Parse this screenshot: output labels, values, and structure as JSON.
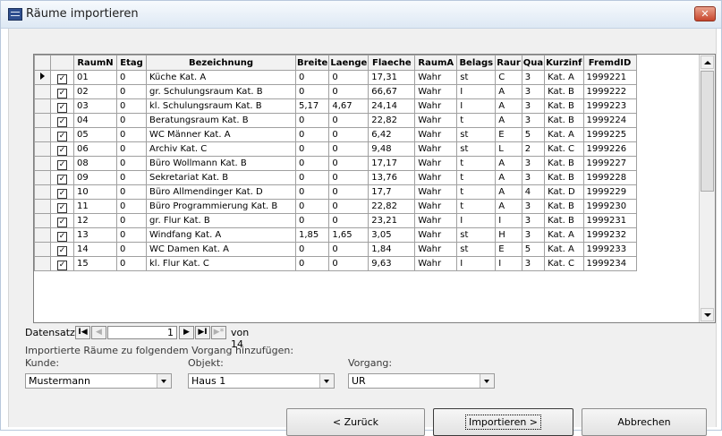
{
  "window": {
    "title": "Räume importieren",
    "close_glyph": "✕"
  },
  "grid": {
    "columns": [
      "RaumNr",
      "Etage",
      "Bezeichnung",
      "Breite",
      "Laenge",
      "Flaeche",
      "RaumArt",
      "Belags",
      "Raum",
      "Qua",
      "Kurzinf",
      "FremdID"
    ],
    "column_labels": [
      "RaumN",
      "Etag",
      "Bezeichnung",
      "Breite",
      "Laenge",
      "Flaeche",
      "RaumA",
      "Belags",
      "Raur",
      "Qua",
      "Kurzinf",
      "FremdID"
    ],
    "rows": [
      {
        "current": true,
        "checked": true,
        "cells": [
          "01",
          "0",
          "Küche Kat. A",
          "0",
          "0",
          "17,31",
          "Wahr",
          "st",
          "C",
          "3",
          "Kat. A",
          "1999221"
        ]
      },
      {
        "current": false,
        "checked": true,
        "cells": [
          "02",
          "0",
          "gr. Schulungsraum Kat. B",
          "0",
          "0",
          "66,67",
          "Wahr",
          "I",
          "A",
          "3",
          "Kat. B",
          "1999222"
        ]
      },
      {
        "current": false,
        "checked": true,
        "cells": [
          "03",
          "0",
          "kl. Schulungsraum Kat. B",
          "5,17",
          "4,67",
          "24,14",
          "Wahr",
          "I",
          "A",
          "3",
          "Kat. B",
          "1999223"
        ]
      },
      {
        "current": false,
        "checked": true,
        "cells": [
          "04",
          "0",
          "Beratungsraum Kat. B",
          "0",
          "0",
          "22,82",
          "Wahr",
          "t",
          "A",
          "3",
          "Kat. B",
          "1999224"
        ]
      },
      {
        "current": false,
        "checked": true,
        "cells": [
          "05",
          "0",
          "WC Männer Kat. A",
          "0",
          "0",
          "6,42",
          "Wahr",
          "st",
          "E",
          "5",
          "Kat. A",
          "1999225"
        ]
      },
      {
        "current": false,
        "checked": true,
        "cells": [
          "06",
          "0",
          "Archiv Kat. C",
          "0",
          "0",
          "9,48",
          "Wahr",
          "st",
          "L",
          "2",
          "Kat. C",
          "1999226"
        ]
      },
      {
        "current": false,
        "checked": true,
        "cells": [
          "08",
          "0",
          "Büro Wollmann Kat. B",
          "0",
          "0",
          "17,17",
          "Wahr",
          "t",
          "A",
          "3",
          "Kat. B",
          "1999227"
        ]
      },
      {
        "current": false,
        "checked": true,
        "cells": [
          "09",
          "0",
          "Sekretariat Kat. B",
          "0",
          "0",
          "13,76",
          "Wahr",
          "t",
          "A",
          "3",
          "Kat. B",
          "1999228"
        ]
      },
      {
        "current": false,
        "checked": true,
        "cells": [
          "10",
          "0",
          "Büro Allmendinger Kat. D",
          "0",
          "0",
          "17,7",
          "Wahr",
          "t",
          "A",
          "4",
          "Kat. D",
          "1999229"
        ]
      },
      {
        "current": false,
        "checked": true,
        "cells": [
          "11",
          "0",
          "Büro Programmierung Kat. B",
          "0",
          "0",
          "22,82",
          "Wahr",
          "t",
          "A",
          "3",
          "Kat. B",
          "1999230"
        ]
      },
      {
        "current": false,
        "checked": true,
        "cells": [
          "12",
          "0",
          "gr. Flur Kat. B",
          "0",
          "0",
          "23,21",
          "Wahr",
          "I",
          "I",
          "3",
          "Kat. B",
          "1999231"
        ]
      },
      {
        "current": false,
        "checked": true,
        "cells": [
          "13",
          "0",
          "Windfang Kat. A",
          "1,85",
          "1,65",
          "3,05",
          "Wahr",
          "st",
          "H",
          "3",
          "Kat. A",
          "1999232"
        ]
      },
      {
        "current": false,
        "checked": true,
        "cells": [
          "14",
          "0",
          "WC Damen Kat. A",
          "0",
          "0",
          "1,84",
          "Wahr",
          "st",
          "E",
          "5",
          "Kat. A",
          "1999233"
        ]
      },
      {
        "current": false,
        "checked": true,
        "cells": [
          "15",
          "0",
          "kl. Flur Kat. C",
          "0",
          "0",
          "9,63",
          "Wahr",
          "I",
          "I",
          "3",
          "Kat. C",
          "1999234"
        ]
      }
    ]
  },
  "navigation": {
    "label": "Datensatz:",
    "first_glyph": "I◀",
    "prev_glyph": "◀",
    "record": "1",
    "next_glyph": "▶",
    "last_glyph": "▶I",
    "new_glyph": "▶*",
    "of_text": "von 14"
  },
  "import_section": {
    "heading": "Importierte Räume zu folgendem Vorgang hinzufügen:",
    "kunde_label": "Kunde:",
    "kunde_value": "Mustermann",
    "objekt_label": "Objekt:",
    "objekt_value": "Haus 1",
    "vorgang_label": "Vorgang:",
    "vorgang_value": "UR"
  },
  "buttons": {
    "back": "< Zurück",
    "import": "Importieren >",
    "cancel": "Abbrechen"
  }
}
